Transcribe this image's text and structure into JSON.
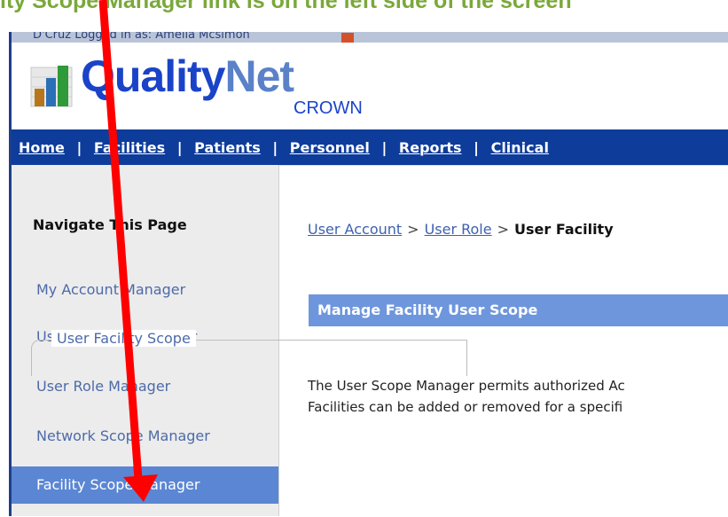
{
  "caption": "ity Scope Manager link is on the left side of the screen",
  "status_strip": {
    "text": "D'Cruz Logged in as: Amelia Mcsimon",
    "icon": "logout-icon"
  },
  "logo": {
    "title_part1": "Quality",
    "title_part2": "Net",
    "subtitle": "CROWN",
    "icon": "bar-chart-logo-icon"
  },
  "nav": {
    "items": [
      "Home",
      "Facilities",
      "Patients",
      "Personnel",
      "Reports",
      "Clinical"
    ],
    "separator": "|"
  },
  "sidebar": {
    "heading": "Navigate This Page",
    "items": [
      "My Account Manager",
      "User Account Manager",
      "User Role Manager",
      "Network Scope Manager",
      "Facility Scope Manager"
    ],
    "active_index": 4
  },
  "main": {
    "breadcrumb": {
      "link1": "User Account",
      "link2": "User Role",
      "current": "User Facility",
      "separator": ">"
    },
    "section_title": "Manage Facility User Scope",
    "description_line1": "The User Scope Manager permits authorized Ac",
    "description_line2": "Facilities can be added or removed for a specifi",
    "fieldset_legend": "User Facility Scope"
  },
  "colors": {
    "caption": "#7aa83a",
    "navbar": "#0e3c9a",
    "active_item": "#5b86d3",
    "section_bar": "#6e96dc",
    "arrow": "#ff0000"
  }
}
